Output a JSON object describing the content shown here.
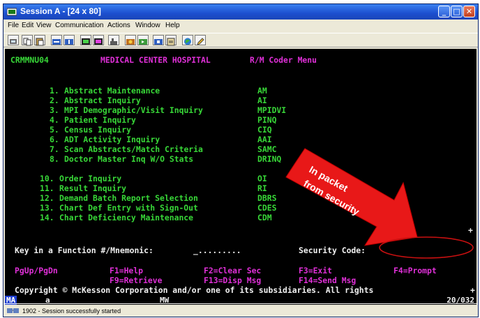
{
  "window": {
    "title": "Session A - [24 x 80]",
    "controls": [
      "minimize",
      "maximize",
      "close"
    ],
    "control_glyphs": {
      "minimize": "_",
      "maximize": "□",
      "close": "✕"
    }
  },
  "menubar": {
    "items": [
      "File",
      "Edit",
      "View",
      "Communication",
      "Actions",
      "Window",
      "Help"
    ]
  },
  "toolbar": {
    "icons": [
      "print-screen-icon",
      "copy-icon",
      "paste-icon",
      "send-icon",
      "receive-icon",
      "display-icon",
      "color-icon",
      "map-icon",
      "record-icon",
      "play-icon",
      "stop-icon",
      "clipboard-icon",
      "globe-icon",
      "edit-icon"
    ]
  },
  "terminal": {
    "header": {
      "screen_id": "CRMMNU04",
      "hospital": "MEDICAL CENTER HOSPITAL",
      "menu_title": "R/M Coder Menu"
    },
    "menu_items": [
      {
        "num": "1.",
        "label": "Abstract Maintenance",
        "code": "AM"
      },
      {
        "num": "2.",
        "label": "Abstract Inquiry",
        "code": "AI"
      },
      {
        "num": "3.",
        "label": "MPI Demographic/Visit Inquiry",
        "code": "MPIDVI"
      },
      {
        "num": "4.",
        "label": "Patient Inquiry",
        "code": "PINQ"
      },
      {
        "num": "5.",
        "label": "Census Inquiry",
        "code": "CIQ"
      },
      {
        "num": "6.",
        "label": "ADT Activity Inquiry",
        "code": "AAI"
      },
      {
        "num": "7.",
        "label": "Scan Abstracts/Match Criteria",
        "code": "SAMC"
      },
      {
        "num": "8.",
        "label": "Doctor Master Inq W/O Stats",
        "code": "DRINQ"
      },
      {
        "num": "10.",
        "label": "Order Inquiry",
        "code": "OI"
      },
      {
        "num": "11.",
        "label": "Result Inquiry",
        "code": "RI"
      },
      {
        "num": "12.",
        "label": "Demand Batch Report Selection",
        "code": "DBRS"
      },
      {
        "num": "13.",
        "label": "Chart Def Entry with Sign-Out",
        "code": "CDES"
      },
      {
        "num": "14.",
        "label": "Chart Deficiency Maintenance",
        "code": "CDM"
      }
    ],
    "more_indicator": "+",
    "prompt": {
      "label": "Key in a Function #/Mnemonic:",
      "value": "_.........",
      "security_label": "Security Code:"
    },
    "fkeys_row1": [
      "PgUp/PgDn",
      "F1=Help",
      "F2=Clear Sec",
      "F3=Exit",
      "F4=Prompt"
    ],
    "fkeys_row2": [
      "F9=Retrieve",
      "F13=Disp Msg",
      "F14=Send Msg"
    ],
    "copyright": "Copyright © McKesson Corporation and/or one of its subsidiaries. All rights",
    "copyright_more": "+"
  },
  "oia": {
    "ma": "MA",
    "session": "a",
    "mw": "MW",
    "cursor_pos": "20/032"
  },
  "statusbar": {
    "text": "1902 - Session successfully started"
  },
  "annotation": {
    "line1": "In packet",
    "line2": "from security",
    "colors": {
      "arrow": "#e81818",
      "circle": "#c81010",
      "text": "#ffffff"
    }
  },
  "colors": {
    "terminal_bg": "#000000",
    "green": "#38d838",
    "magenta": "#e030d8",
    "white": "#f0f0f0",
    "titlebar": "#1c4fcf"
  }
}
